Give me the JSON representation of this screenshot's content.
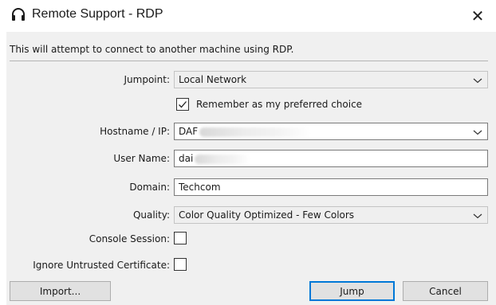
{
  "window": {
    "title": "Remote Support - RDP",
    "close_glyph": "✕"
  },
  "dialog": {
    "info_text": "This will attempt to connect to another machine using RDP."
  },
  "form": {
    "jumpoint": {
      "label": "Jumpoint:",
      "value": "Local Network"
    },
    "remember": {
      "label": "Remember as my preferred choice",
      "checked": true
    },
    "hostname": {
      "label": "Hostname / IP:",
      "value_visible": "DAF"
    },
    "username": {
      "label": "User Name:",
      "value_visible": "dai"
    },
    "domain": {
      "label": "Domain:",
      "value": "Techcom"
    },
    "quality": {
      "label": "Quality:",
      "value": "Color Quality Optimized - Few Colors"
    },
    "console_session": {
      "label": "Console Session:",
      "checked": false
    },
    "ignore_cert": {
      "label": "Ignore Untrusted Certificate:",
      "checked": false
    }
  },
  "buttons": {
    "import": "Import...",
    "jump": "Jump",
    "cancel": "Cancel"
  },
  "colors": {
    "accent": "#0078d7",
    "dialog_bg": "#f0f0f0"
  },
  "icons": {
    "app": "headset-icon",
    "close": "close-icon",
    "dropdown": "chevron-down-icon",
    "check": "checkmark-icon"
  }
}
